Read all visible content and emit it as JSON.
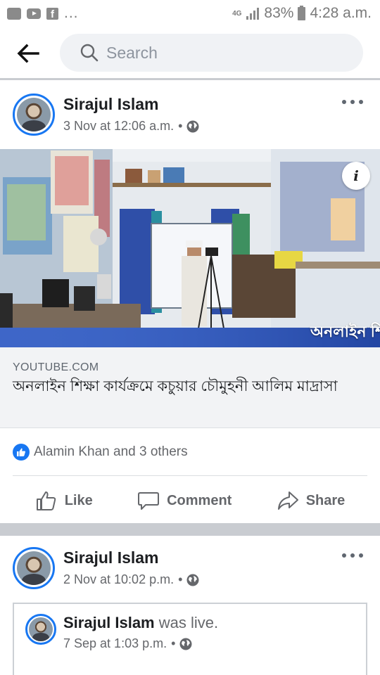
{
  "status_bar": {
    "notification_icons": [
      "message-icon",
      "youtube-icon",
      "facebook-icon"
    ],
    "overflow": "...",
    "network": "4G",
    "battery": "83%",
    "time": "4:28 a.m."
  },
  "header": {
    "search_placeholder": "Search"
  },
  "posts": [
    {
      "author": "Sirajul Islam",
      "timestamp": "3 Nov at 12:06 a.m.",
      "separator": "•",
      "link": {
        "domain": "YOUTUBE.COM",
        "title": "অনলাইন শিক্ষা কার্যক্রমে কচুয়ার চৌমুহনী আলিম মাদ্রাসা",
        "thumbnail_caption": "অনলাইন শি",
        "info_label": "i"
      },
      "reactions": "Alamin Khan and 3 others",
      "actions": {
        "like": "Like",
        "comment": "Comment",
        "share": "Share"
      }
    },
    {
      "author": "Sirajul Islam",
      "timestamp": "2 Nov at 10:02 p.m.",
      "separator": "•",
      "shared": {
        "author": "Sirajul Islam",
        "status": "was live.",
        "timestamp": "7 Sep at 1:03 p.m.",
        "separator": "•"
      }
    }
  ],
  "colors": {
    "accent": "#1877f2",
    "secondary_text": "#65676b",
    "divider": "#c9ccd1"
  }
}
